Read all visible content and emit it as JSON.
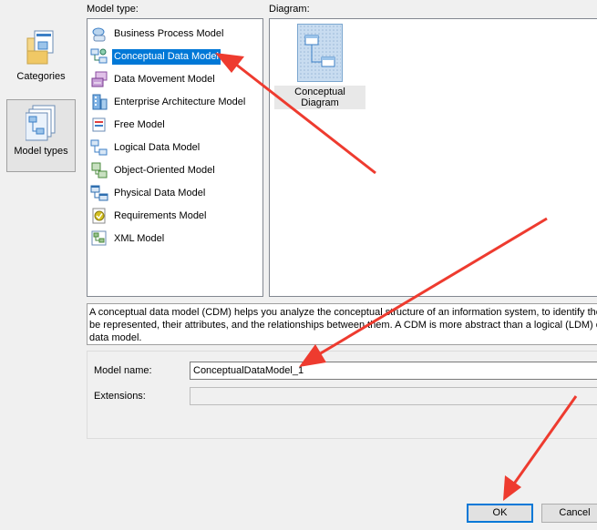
{
  "categories": [
    {
      "label": "Categories",
      "icon": "folder-categories-icon",
      "selected": false
    },
    {
      "label": "Model types",
      "icon": "model-types-icon",
      "selected": true
    }
  ],
  "model_type_label": "Model type:",
  "diagram_label": "Diagram:",
  "model_types": [
    {
      "label": "Business Process Model",
      "icon": "business-process-model-icon",
      "selected": false
    },
    {
      "label": "Conceptual Data Model",
      "icon": "conceptual-data-model-icon",
      "selected": true
    },
    {
      "label": "Data Movement Model",
      "icon": "data-movement-model-icon",
      "selected": false
    },
    {
      "label": "Enterprise Architecture Model",
      "icon": "enterprise-architecture-model-icon",
      "selected": false
    },
    {
      "label": "Free Model",
      "icon": "free-model-icon",
      "selected": false
    },
    {
      "label": "Logical Data Model",
      "icon": "logical-data-model-icon",
      "selected": false
    },
    {
      "label": "Object-Oriented Model",
      "icon": "object-oriented-model-icon",
      "selected": false
    },
    {
      "label": "Physical Data Model",
      "icon": "physical-data-model-icon",
      "selected": false
    },
    {
      "label": "Requirements Model",
      "icon": "requirements-model-icon",
      "selected": false
    },
    {
      "label": "XML Model",
      "icon": "xml-model-icon",
      "selected": false
    }
  ],
  "diagrams": [
    {
      "label": "Conceptual Diagram",
      "icon": "conceptual-diagram-icon"
    }
  ],
  "description": "A conceptual data model (CDM) helps you analyze the conceptual structure of an information system, to identify the prin\nbe represented, their attributes, and the relationships between them. A CDM is more abstract than a logical (LDM) or phy\ndata model.",
  "form": {
    "model_name_label": "Model name:",
    "model_name_value": "ConceptualDataModel_1",
    "extensions_label": "Extensions:",
    "extensions_value": ""
  },
  "buttons": {
    "ok": "OK",
    "cancel": "Cancel"
  },
  "colors": {
    "selection": "#0078d7",
    "annotation_arrow": "#ee3b2f"
  }
}
